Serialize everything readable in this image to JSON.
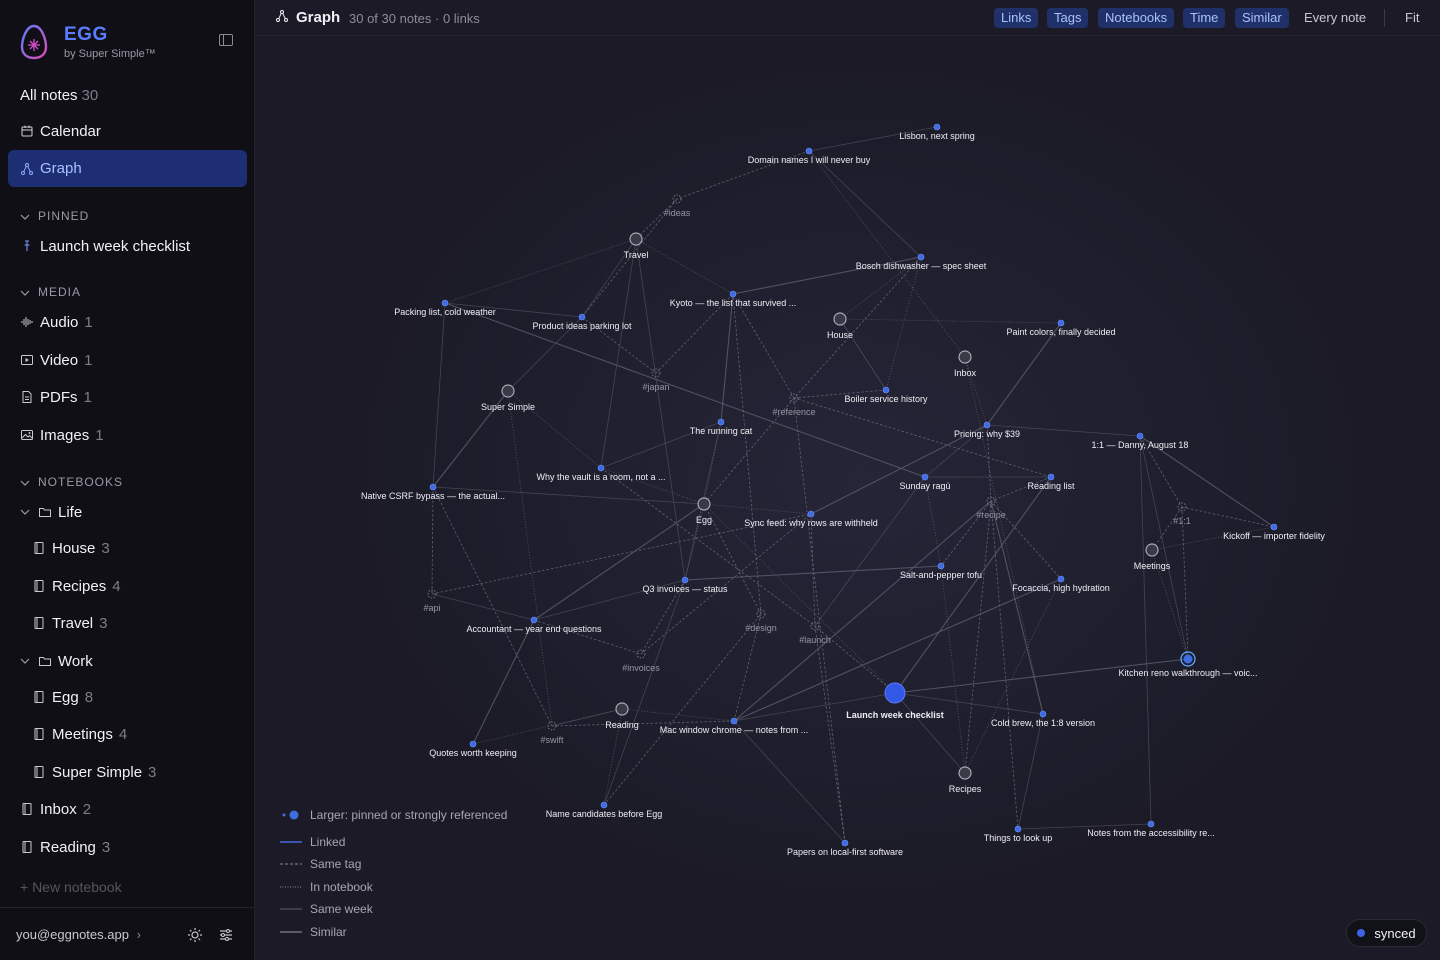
{
  "brand": {
    "name": "EGG",
    "subtitle": "by Super Simple™"
  },
  "nav": [
    {
      "label": "All notes",
      "count": "30",
      "icon": "none"
    },
    {
      "label": "Calendar",
      "count": "",
      "icon": "calendar-icon"
    },
    {
      "label": "Graph",
      "count": "",
      "icon": "graph-icon",
      "active": true
    }
  ],
  "pinned": {
    "header": "PINNED",
    "items": [
      {
        "label": "Launch week checklist",
        "icon": "pin-icon"
      }
    ]
  },
  "media": {
    "header": "MEDIA",
    "items": [
      {
        "label": "Audio",
        "count": "1",
        "icon": "audio-icon"
      },
      {
        "label": "Video",
        "count": "1",
        "icon": "video-icon"
      },
      {
        "label": "PDFs",
        "count": "1",
        "icon": "pdf-icon"
      },
      {
        "label": "Images",
        "count": "1",
        "icon": "image-icon"
      }
    ]
  },
  "notebooks": {
    "header": "NOTEBOOKS",
    "groups": [
      {
        "label": "Life",
        "children": [
          {
            "label": "House",
            "count": "3"
          },
          {
            "label": "Recipes",
            "count": "4"
          },
          {
            "label": "Travel",
            "count": "3"
          }
        ]
      },
      {
        "label": "Work",
        "children": [
          {
            "label": "Egg",
            "count": "8"
          },
          {
            "label": "Meetings",
            "count": "4"
          },
          {
            "label": "Super Simple",
            "count": "3"
          }
        ]
      }
    ],
    "top_level": [
      {
        "label": "Inbox",
        "count": "2"
      },
      {
        "label": "Reading",
        "count": "3"
      }
    ],
    "new_label": "+ New notebook"
  },
  "account": {
    "email": "you@eggnotes.app",
    "chevron": "›"
  },
  "topbar": {
    "title": "Graph",
    "meta": "30 of 30 notes · 0 links",
    "filters": [
      "Links",
      "Tags",
      "Notebooks",
      "Time",
      "Similar"
    ],
    "every_note": "Every note",
    "fit": "Fit"
  },
  "legend": {
    "larger": "Larger: pinned or strongly referenced",
    "linked": "Linked",
    "same_tag": "Same tag",
    "in_notebook": "In notebook",
    "same_week": "Same week",
    "similar": "Similar"
  },
  "status": {
    "synced": "synced"
  },
  "colors": {
    "accent": "#5b7cff",
    "node": "#3f6de0",
    "active_bg": "#1e2e73",
    "selected": "#5aa9ff"
  },
  "graph": {
    "notes": [
      "Lisbon, next spring",
      "Domain names I will never buy",
      "Bosch dishwasher — spec sheet",
      "Kyoto — the list that survived ...",
      "Packing list, cold weather",
      "Product ideas parking lot",
      "Paint colors, finally decided",
      "Boiler service history",
      "The running cat",
      "Pricing: why $39",
      "1:1 — Danny, August 18",
      "Why the vault is a room, not a ...",
      "Native CSRF bypass — the actual...",
      "Sunday ragù",
      "Reading list",
      "Sync feed: why rows are withheld",
      "Kickoff — importer fidelity",
      "Salt-and-pepper tofu",
      "Focaccia, high hydration",
      "Q3 invoices — status",
      "Accountant — year end questions",
      "Kitchen reno walkthrough — voic...",
      "Launch week checklist",
      "Mac window chrome — notes from ...",
      "Cold brew, the 1:8 version",
      "Quotes worth keeping",
      "Name candidates before Egg",
      "Papers on local-first software",
      "Things to look up",
      "Notes from the accessibility re..."
    ],
    "notebooks": [
      "Travel",
      "House",
      "Inbox",
      "Super Simple",
      "Egg",
      "Meetings",
      "Reading",
      "Recipes"
    ],
    "tags": [
      "#ideas",
      "#japan",
      "#reference",
      "#recipe",
      "#1:1",
      "#api",
      "#design",
      "#launch",
      "#invoices",
      "#swift"
    ]
  }
}
